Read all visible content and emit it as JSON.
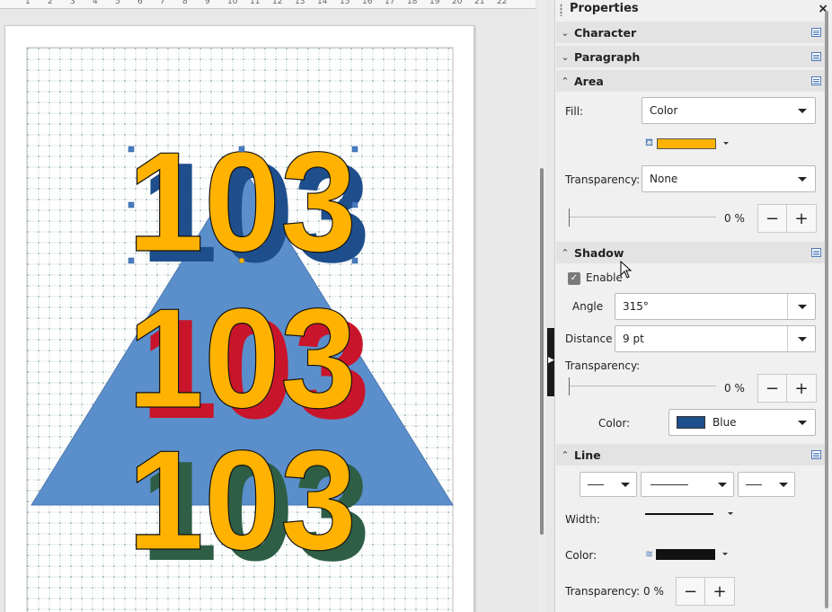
{
  "ruler": {
    "numbers": [
      "1",
      "2",
      "3",
      "4",
      "5",
      "6",
      "7",
      "8",
      "9",
      "10",
      "11",
      "12",
      "13",
      "14",
      "15",
      "16",
      "17",
      "18",
      "19",
      "20",
      "21",
      "22"
    ]
  },
  "canvas": {
    "texts": [
      "103",
      "103",
      "103"
    ],
    "colors": {
      "fill": "#FFB300",
      "shadow_blue": "#1E4E8C",
      "shadow_red": "#C9152B",
      "shadow_green": "#2E5E45",
      "triangle": "#5B8FCB"
    }
  },
  "sidebar": {
    "title": "Properties",
    "close": "×",
    "sections": {
      "character": "Character",
      "paragraph": "Paragraph",
      "area": "Area",
      "shadow": "Shadow",
      "line": "Line"
    },
    "area": {
      "fill_label": "Fill:",
      "fill_value": "Color",
      "fill_color": "#FFB300",
      "transparency_label": "Transparency:",
      "transparency_value": "None",
      "percent": "0 %"
    },
    "shadow": {
      "enable_label": "Enable",
      "angle_label": "Angle",
      "angle_value": "315°",
      "distance_label": "Distance",
      "distance_value": "9 pt",
      "transparency_label": "Transparency:",
      "percent": "0 %",
      "color_label": "Color:",
      "color_value": "Blue",
      "color_hex": "#1E4E8C"
    },
    "line": {
      "width_label": "Width:",
      "color_label": "Color:",
      "color_hex": "#111111",
      "transparency_label": "Transparency:",
      "transparency_value": "0 %"
    },
    "spin": {
      "minus": "−",
      "plus": "+"
    }
  }
}
